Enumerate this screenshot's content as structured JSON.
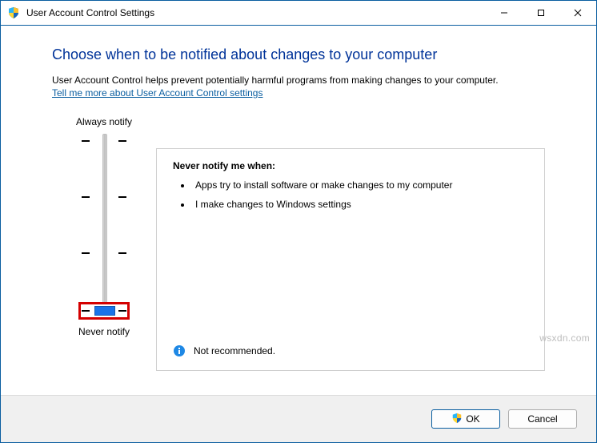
{
  "window": {
    "title": "User Account Control Settings"
  },
  "heading": "Choose when to be notified about changes to your computer",
  "intro": "User Account Control helps prevent potentially harmful programs from making changes to your computer.",
  "link": "Tell me more about User Account Control settings",
  "slider": {
    "top_label": "Always notify",
    "bottom_label": "Never notify",
    "levels": 4,
    "selected_index": 3
  },
  "panel": {
    "title": "Never notify me when:",
    "bullets": [
      "Apps try to install software or make changes to my computer",
      "I make changes to Windows settings"
    ],
    "recommendation": "Not recommended."
  },
  "buttons": {
    "ok": "OK",
    "cancel": "Cancel"
  },
  "watermark": "wsxdn.com"
}
